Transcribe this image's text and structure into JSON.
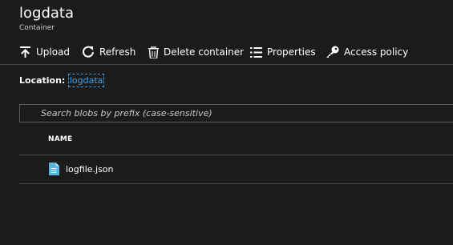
{
  "header": {
    "title": "logdata",
    "subtitle": "Container"
  },
  "toolbar": {
    "upload_label": "Upload",
    "refresh_label": "Refresh",
    "delete_label": "Delete container",
    "properties_label": "Properties",
    "access_policy_label": "Access policy"
  },
  "location": {
    "label": "Location:",
    "link": "logdata"
  },
  "search": {
    "placeholder": "Search blobs by prefix (case-sensitive)"
  },
  "table": {
    "columns": [
      "NAME"
    ],
    "rows": [
      {
        "name": "logfile.json",
        "icon": "file-icon"
      }
    ]
  },
  "colors": {
    "background": "#1b1b1c",
    "link": "#3ba3f0",
    "file_icon": "#59b4d9"
  }
}
